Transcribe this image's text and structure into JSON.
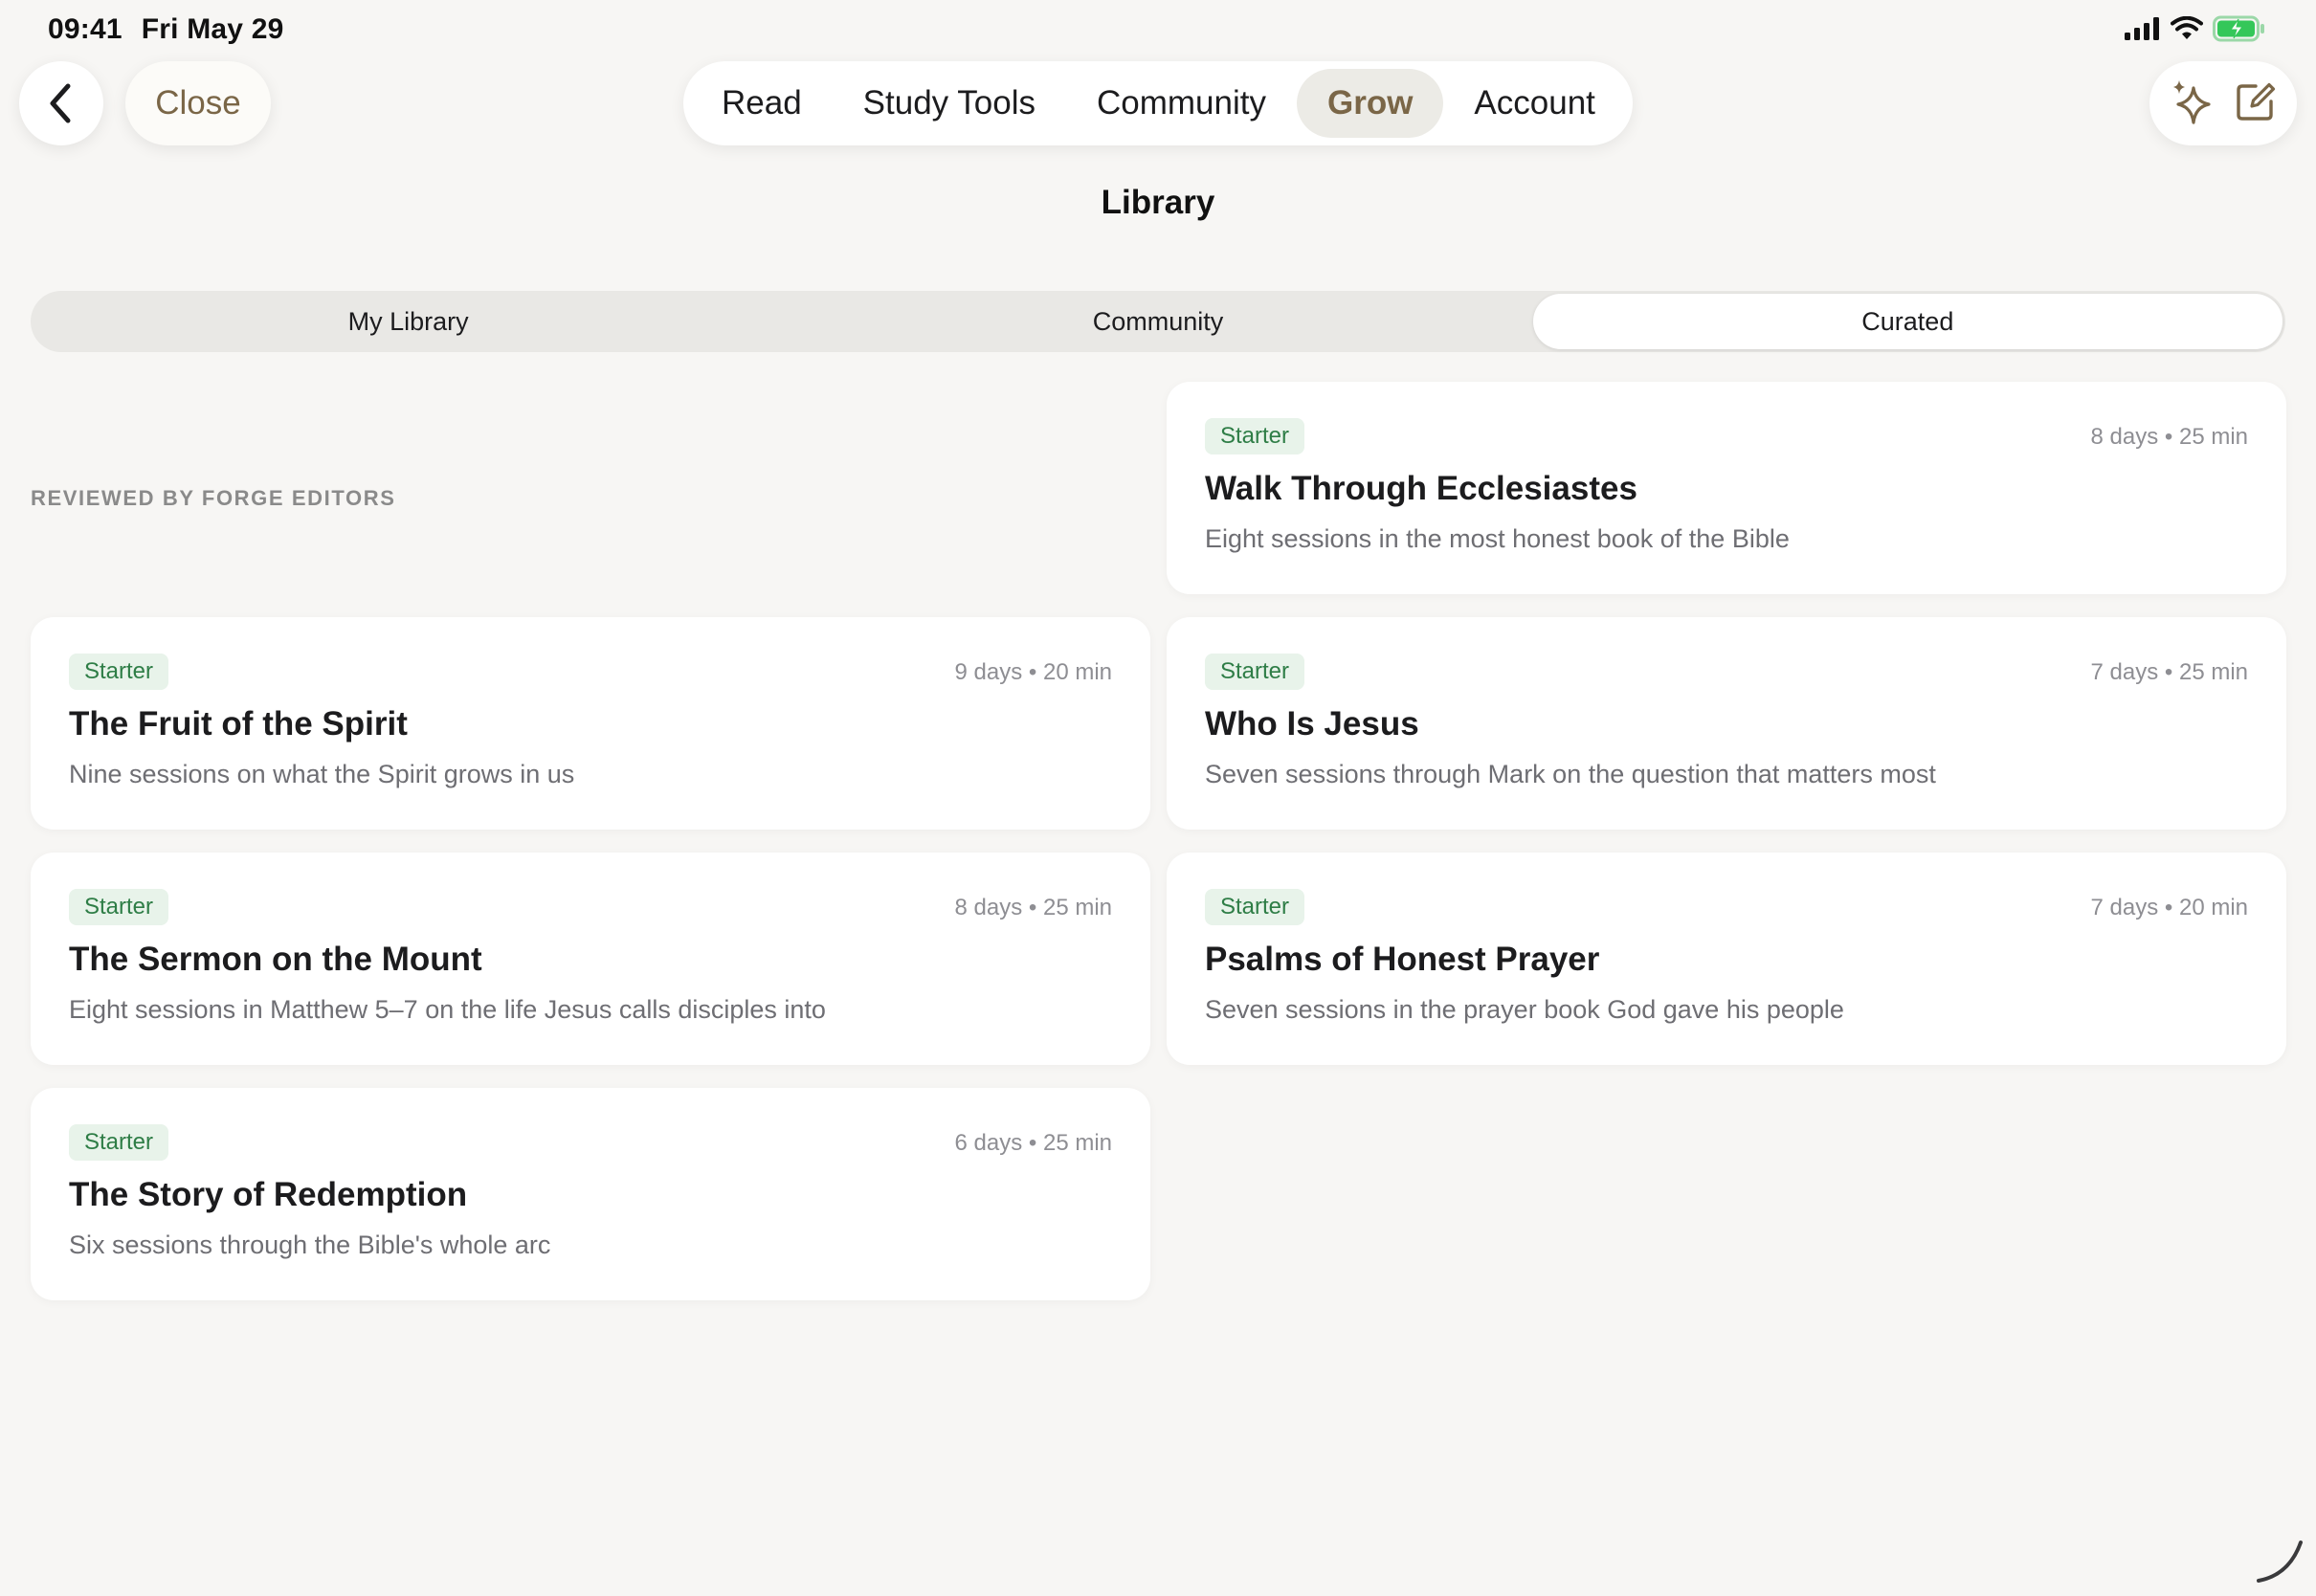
{
  "status": {
    "time": "09:41",
    "date": "Fri May 29"
  },
  "nav": {
    "close_label": "Close",
    "tabs": [
      "Read",
      "Study Tools",
      "Community",
      "Grow",
      "Account"
    ],
    "active_tab": "Grow"
  },
  "page": {
    "title": "Library"
  },
  "segments": {
    "items": [
      "My Library",
      "Community",
      "Curated"
    ],
    "active": "Curated"
  },
  "section": {
    "label": "REVIEWED BY FORGE EDITORS"
  },
  "cards": [
    {
      "badge": "Starter",
      "meta": "8 days • 25 min",
      "title": "Walk Through Ecclesiastes",
      "subtitle": "Eight sessions in the most honest book of the Bible"
    },
    {
      "badge": "Starter",
      "meta": "9 days • 20 min",
      "title": "The Fruit of the Spirit",
      "subtitle": "Nine sessions on what the Spirit grows in us"
    },
    {
      "badge": "Starter",
      "meta": "7 days • 25 min",
      "title": "Who Is Jesus",
      "subtitle": "Seven sessions through Mark on the question that matters most"
    },
    {
      "badge": "Starter",
      "meta": "8 days • 25 min",
      "title": "The Sermon on the Mount",
      "subtitle": "Eight sessions in Matthew 5–7 on the life Jesus calls disciples into"
    },
    {
      "badge": "Starter",
      "meta": "7 days • 20 min",
      "title": "Psalms of Honest Prayer",
      "subtitle": "Seven sessions in the prayer book God gave his people"
    },
    {
      "badge": "Starter",
      "meta": "6 days • 25 min",
      "title": "The Story of Redemption",
      "subtitle": "Six sessions through the Bible's whole arc"
    }
  ],
  "icons": {
    "back": "chevron-left-icon",
    "ai": "sparkles-icon",
    "compose": "compose-icon",
    "signal": "cellular-signal-icon",
    "wifi": "wifi-icon",
    "battery": "battery-charging-icon"
  },
  "colors": {
    "accent": "#7a6647",
    "badge_bg": "#e8f3ea",
    "badge_text": "#2e7d46",
    "background": "#f7f6f4",
    "battery": "#34c759"
  }
}
